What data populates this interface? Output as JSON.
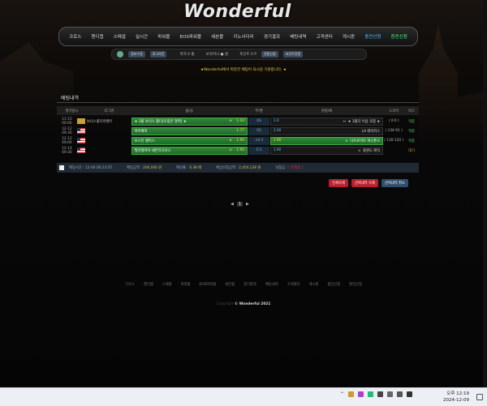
{
  "logo": "Wonderful",
  "nav": [
    {
      "label": "크로스",
      "style": ""
    },
    {
      "label": "핸디캡",
      "style": ""
    },
    {
      "label": "스페셜",
      "style": ""
    },
    {
      "label": "실시간",
      "style": ""
    },
    {
      "label": "파워볼",
      "style": ""
    },
    {
      "label": "EOS파워볼",
      "style": ""
    },
    {
      "label": "세븐볼",
      "style": ""
    },
    {
      "label": "키노사다리",
      "style": ""
    },
    {
      "label": "경기결과",
      "style": ""
    },
    {
      "label": "배팅내역",
      "style": ""
    },
    {
      "label": "고객센터",
      "style": ""
    },
    {
      "label": "게시판",
      "style": ""
    },
    {
      "label": "충전신청",
      "style": "hl"
    },
    {
      "label": "환전신청",
      "style": "gr"
    }
  ],
  "userbar": {
    "btn1": "정보수정",
    "btn2": "로그아웃",
    "level": "쪽지 0 통",
    "money": "보유머니 ● 원",
    "point": "포인트 0 P",
    "btn3": "전환신청",
    "btn4": "포인트전환"
  },
  "notice": "★Wonderful에서 따뜻한 배팅이 되시길 기원합니다. ★",
  "page_title": "배팅내역",
  "table_headers": [
    "경기일시",
    "리그명",
    "홈/승",
    "무/핸",
    "원정/패",
    "스코어",
    "비고"
  ],
  "rows": [
    {
      "date": "11-15 00:00",
      "flag": "kor",
      "league": "보너스폴더이벤트",
      "home": "★ 3폴 보너스 폴더(오징은 경력) ★",
      "home_h": "H",
      "home_odd": "1.03",
      "draw": "VS",
      "away_odd": "1.0",
      "away": "★ 3폴더 이상 조합 ★",
      "away_h": "H",
      "score": "( 0:0 )",
      "result": "적중",
      "home_dark": false,
      "away_green": false
    },
    {
      "date": "12-12 09:30",
      "flag": "us",
      "league": "",
      "home": "마이애미",
      "home_h": "",
      "home_odd": "1.77",
      "draw": "VS",
      "away_odd": "2.00",
      "away": "LA 레이커스",
      "away_h": "",
      "score": "( 134:91 )",
      "result": "적중",
      "home_dark": false,
      "away_green": false
    },
    {
      "date": "12-12 09:00",
      "flag": "us",
      "league": "",
      "home": "보스턴 셀틱스",
      "home_h": "H",
      "home_odd": "1.90",
      "draw": "-14.5",
      "away_odd": "1.90",
      "away": "디트로이트 피스톤스",
      "away_h": "H",
      "score": "( 130:120 )",
      "result": "적중",
      "home_dark": false,
      "away_green": true
    },
    {
      "date": "12-14 09:30",
      "flag": "us",
      "league": "",
      "home": "필라델피아 세븐티식서스",
      "home_h": "U",
      "home_odd": "1.90",
      "draw": "5.5",
      "away_odd": "1.90",
      "away": "올랜도 매직",
      "away_h": "H",
      "score": "",
      "result": "대기",
      "home_dark": false,
      "away_green": false
    }
  ],
  "summary": {
    "bet_time": "배팅시간 : 12-09 06:23:55",
    "bet_amount_label": "배팅금액 :",
    "bet_amount": "200,000 원",
    "odds_label": "배당률 :",
    "odds": "6.38 배",
    "expected_label": "예상당첨금액 :",
    "expected": "2,450,138 원",
    "result_label": "당첨금 :",
    "result": "[ 진행중 ]"
  },
  "buttons": {
    "delete_all": "전체삭제",
    "delete_selected": "선택내역 삭제",
    "cancel_selected": "선택내역 취소"
  },
  "pager": {
    "prev": "◀",
    "current": "1",
    "next": "▶"
  },
  "footer_nav": [
    "크로스",
    "핸디캡",
    "스페셜",
    "파워볼",
    "EOS파워볼",
    "세븐볼",
    "경기결과",
    "배팅내역",
    "고객센터",
    "게시판",
    "충전신청",
    "환전신청"
  ],
  "copyright_prefix": "Copyright",
  "copyright": "© Wonderful 2021",
  "taskbar": {
    "time": "오후 12:19",
    "date": "2024-12-09"
  }
}
